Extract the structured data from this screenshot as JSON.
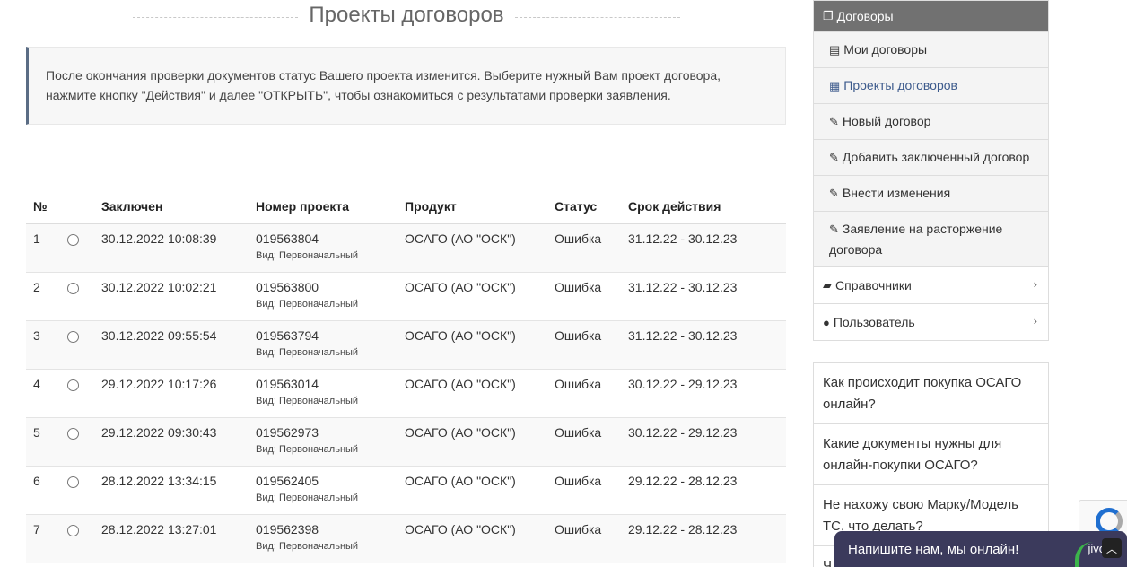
{
  "page": {
    "title": "Проекты договоров"
  },
  "info": {
    "text": "После окончания проверки документов статус Вашего проекта изменится. Выберите нужный Вам проект договора, нажмите кнопку \"Действия\" и далее \"ОТКРЫТЬ\", чтобы ознакомиться с результатами проверки заявления."
  },
  "table": {
    "headers": {
      "num": "№",
      "concluded": "Заключен",
      "project": "Номер проекта",
      "product": "Продукт",
      "status": "Статус",
      "term": "Срок действия"
    },
    "rows": [
      {
        "num": "1",
        "concluded": "30.12.2022 10:08:39",
        "project": "019563804",
        "kind": "Вид: Первоначальный",
        "product": "ОСАГО (АО \"ОСК\")",
        "status": "Ошибка",
        "term": "31.12.22 - 30.12.23"
      },
      {
        "num": "2",
        "concluded": "30.12.2022 10:02:21",
        "project": "019563800",
        "kind": "Вид: Первоначальный",
        "product": "ОСАГО (АО \"ОСК\")",
        "status": "Ошибка",
        "term": "31.12.22 - 30.12.23"
      },
      {
        "num": "3",
        "concluded": "30.12.2022 09:55:54",
        "project": "019563794",
        "kind": "Вид: Первоначальный",
        "product": "ОСАГО (АО \"ОСК\")",
        "status": "Ошибка",
        "term": "31.12.22 - 30.12.23"
      },
      {
        "num": "4",
        "concluded": "29.12.2022 10:17:26",
        "project": "019563014",
        "kind": "Вид: Первоначальный",
        "product": "ОСАГО (АО \"ОСК\")",
        "status": "Ошибка",
        "term": "30.12.22 - 29.12.23"
      },
      {
        "num": "5",
        "concluded": "29.12.2022 09:30:43",
        "project": "019562973",
        "kind": "Вид: Первоначальный",
        "product": "ОСАГО (АО \"ОСК\")",
        "status": "Ошибка",
        "term": "30.12.22 - 29.12.23"
      },
      {
        "num": "6",
        "concluded": "28.12.2022 13:34:15",
        "project": "019562405",
        "kind": "Вид: Первоначальный",
        "product": "ОСАГО (АО \"ОСК\")",
        "status": "Ошибка",
        "term": "29.12.22 - 28.12.23"
      },
      {
        "num": "7",
        "concluded": "28.12.2022 13:27:01",
        "project": "019562398",
        "kind": "Вид: Первоначальный",
        "product": "ОСАГО (АО \"ОСК\")",
        "status": "Ошибка",
        "term": "29.12.22 - 28.12.23"
      }
    ]
  },
  "sidebar": {
    "header": {
      "label": "Договоры",
      "icon": "copy-icon"
    },
    "items": [
      {
        "label": "Мои договоры",
        "icon": "file-icon"
      },
      {
        "label": "Проекты договоров",
        "icon": "word-file-icon",
        "active": true
      },
      {
        "label": "Новый договор",
        "icon": "edit-icon"
      },
      {
        "label": "Добавить заключенный договор",
        "icon": "edit-icon"
      },
      {
        "label": "Внести изменения",
        "icon": "edit-icon"
      },
      {
        "label": "Заявление на расторжение договора",
        "icon": "edit-icon"
      }
    ],
    "groups": [
      {
        "label": "Справочники",
        "icon": "folder-open-icon"
      },
      {
        "label": "Пользователь",
        "icon": "user-icon"
      }
    ]
  },
  "faq": [
    "Как происходит покупка ОСАГО онлайн?",
    "Какие документы нужны для онлайн-покупки ОСАГО?",
    "Не нахожу свою Марку/Модель ТС, что делать?",
    "Что"
  ],
  "chat": {
    "label": "Напишите нам, мы онлайн!",
    "brand": "jivo"
  },
  "colors": {
    "sidebar_header": "#717171",
    "info_accent": "#5a6c84",
    "chat_bg": "#3b3a5c",
    "active_link": "#3c5a8c"
  }
}
